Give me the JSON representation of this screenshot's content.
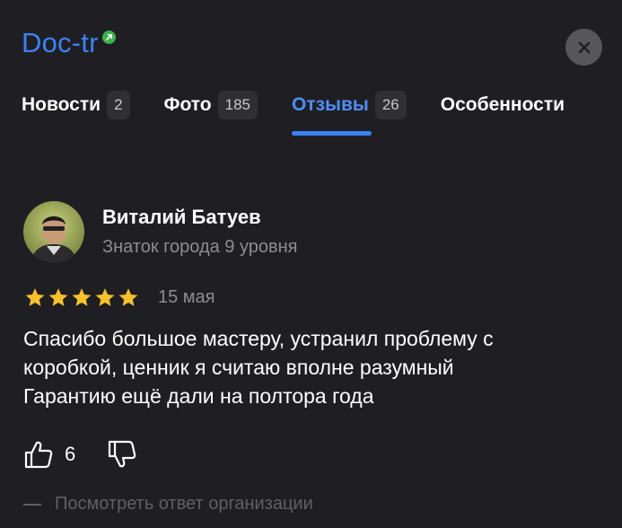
{
  "header": {
    "org_name": "Doc-tr",
    "verified_icon": "verified-arrow-icon",
    "close_icon": "close-icon"
  },
  "tabs": [
    {
      "label": "Новости",
      "count": "2",
      "active": false
    },
    {
      "label": "Фото",
      "count": "185",
      "active": false
    },
    {
      "label": "Отзывы",
      "count": "26",
      "active": true
    },
    {
      "label": "Особенности",
      "count": "",
      "active": false
    }
  ],
  "review": {
    "author": "Виталий Батуев",
    "level": "Знаток города 9 уровня",
    "rating": 5,
    "rating_max": 5,
    "date": "15 мая",
    "text_lines": [
      "Спасибо большое мастеру, устранил проблему с",
      "коробкой, ценник я считаю вполне разумный",
      "Гарантию ещё дали на полтора года"
    ],
    "likes": "6",
    "org_reply_link": "Посмотреть ответ организации"
  },
  "colors": {
    "background": "#1f1f23",
    "accent": "#3b82f6",
    "star": "#f7c12c",
    "verified": "#3db34a",
    "muted_text": "#8c8c91"
  }
}
